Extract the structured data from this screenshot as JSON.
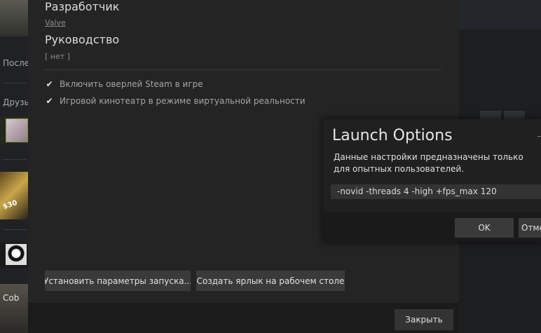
{
  "background": {
    "recent_label": "Послед",
    "friends_label": "Друзья",
    "game_label": "Cob",
    "price_badge": "$30"
  },
  "properties": {
    "developer_heading": "Разработчик",
    "developer_value": "Valve",
    "guide_heading": "Руководство",
    "guide_value": "[ нет ]",
    "checkboxes": [
      {
        "label": "Включить оверлей Steam в игре",
        "checked": true
      },
      {
        "label": "Игровой кинотеатр в режиме виртуальной реальности",
        "checked": true
      }
    ],
    "set_launch_button": "Установить параметры запуска...",
    "shortcut_button": "Создать ярлык на рабочем столе",
    "close_button": "Закрыть"
  },
  "launch_dialog": {
    "title": "Launch Options",
    "description": "Данные настройки предназначены только для опытных пользователей.",
    "input_value": "-novid -threads 4 -high +fps_max 120",
    "ok_button": "OK",
    "cancel_button": "Отмена"
  },
  "icons": {
    "checkbox": "check-icon"
  }
}
